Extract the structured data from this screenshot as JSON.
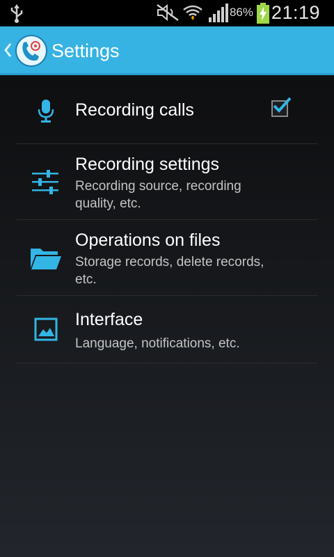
{
  "status_bar": {
    "icons": [
      "usb-icon",
      "mute-icon",
      "wifi-icon",
      "signal-icon",
      "battery-charging-icon"
    ],
    "battery_percent": "86%",
    "time": "21:19"
  },
  "action_bar": {
    "title": "Settings",
    "app_icon": "call-recorder-icon"
  },
  "settings": {
    "items": [
      {
        "title": "Recording calls",
        "summary": "",
        "icon": "microphone-icon",
        "checked": true
      },
      {
        "title": "Recording settings",
        "summary": "Recording source, recording quality, etc.",
        "icon": "sliders-icon"
      },
      {
        "title": "Operations on files",
        "summary": "Storage records, delete records, etc.",
        "icon": "folder-icon"
      },
      {
        "title": "Interface",
        "summary": "Language, notifications, etc.",
        "icon": "image-icon"
      }
    ]
  },
  "colors": {
    "accent": "#36b3e3",
    "icon_blue": "#33b5e5",
    "status_bar_bg": "#000000"
  }
}
